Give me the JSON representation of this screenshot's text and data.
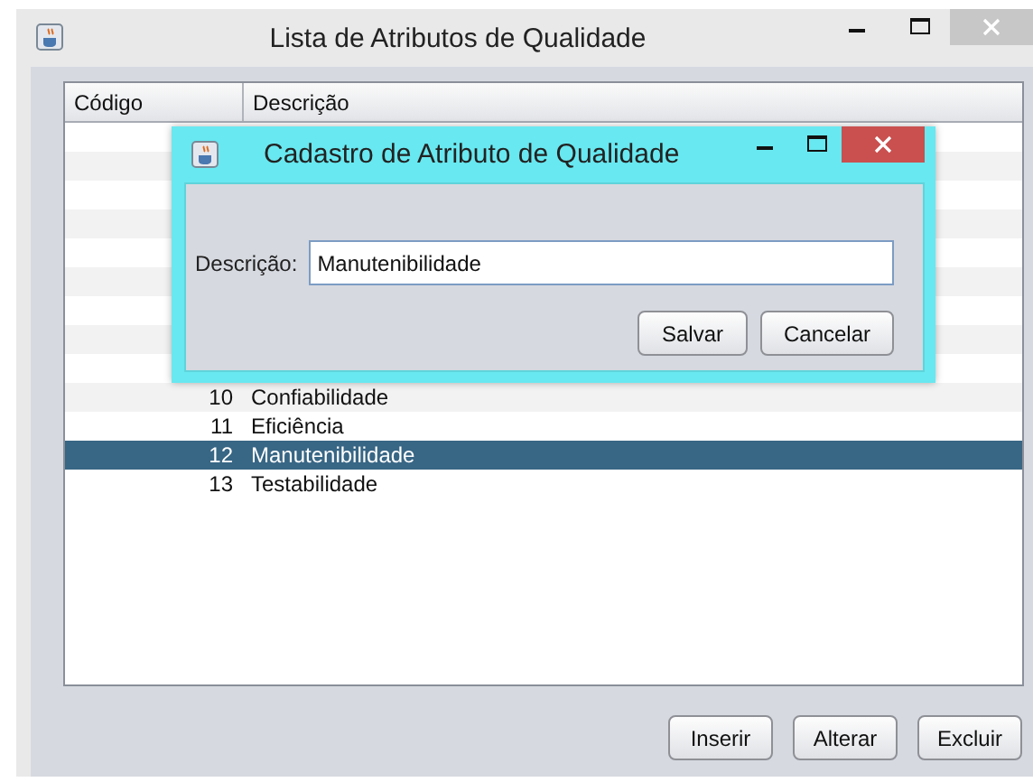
{
  "window": {
    "title": "Lista de Atributos de Qualidade"
  },
  "table": {
    "columns": [
      "Código",
      "Descrição"
    ],
    "rows": [
      {
        "code": "10",
        "description": "Confiabilidade",
        "selected": false
      },
      {
        "code": "11",
        "description": "Eficiência",
        "selected": false
      },
      {
        "code": "12",
        "description": "Manutenibilidade",
        "selected": true
      },
      {
        "code": "13",
        "description": "Testabilidade",
        "selected": false
      }
    ]
  },
  "dialog": {
    "title": "Cadastro de Atributo de Qualidade",
    "field_label": "Descrição:",
    "field_value": "Manutenibilidade",
    "buttons": [
      "Salvar",
      "Cancelar"
    ]
  },
  "buttons": [
    "Inserir",
    "Alterar",
    "Excluir"
  ]
}
